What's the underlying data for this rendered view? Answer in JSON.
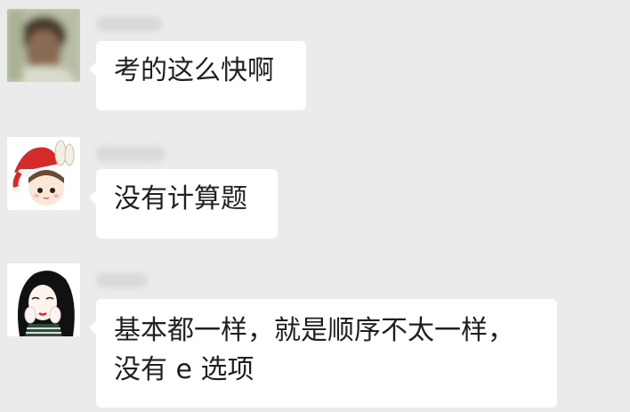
{
  "chat": {
    "messages": [
      {
        "avatar_icon": "blurred-photo-avatar",
        "lines": [
          "考的这么快啊"
        ]
      },
      {
        "avatar_icon": "cartoon-girl-santa-hat-avatar",
        "lines": [
          "没有计算题"
        ]
      },
      {
        "avatar_icon": "illustrated-girl-black-hair-avatar",
        "lines": [
          "基本都一样，就是顺序不太一样，",
          "没有 e 选项"
        ]
      }
    ],
    "colors": {
      "background": "#ebebeb",
      "bubble": "#ffffff",
      "text": "#1f1f1f"
    }
  }
}
